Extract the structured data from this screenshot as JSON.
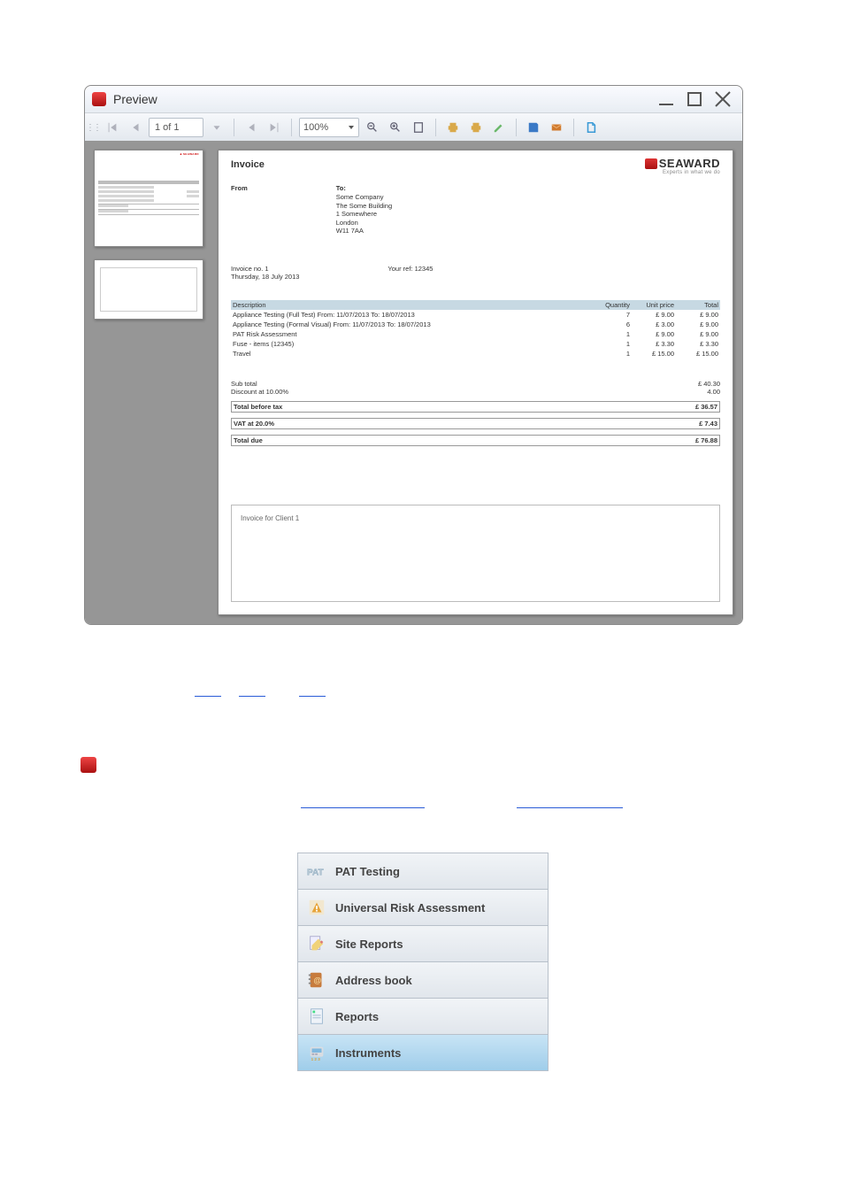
{
  "window": {
    "title": "Preview"
  },
  "toolbar": {
    "page_position": "1 of 1",
    "zoom": "100%"
  },
  "invoice": {
    "title": "Invoice",
    "brand_name": "SEAWARD",
    "brand_tagline": "Experts in what we do",
    "from_label": "From",
    "to_label": "To:",
    "to_lines": [
      "Some Company",
      "The Some Building",
      "1 Somewhere",
      "London",
      "W11 7AA"
    ],
    "invoice_no_label": "Invoice no. 1",
    "invoice_date": "Thursday, 18 July 2013",
    "your_ref_label": "Your ref: 12345"
  },
  "items": {
    "headers": {
      "desc": "Description",
      "qty": "Quantity",
      "unit": "Unit price",
      "total": "Total"
    },
    "rows": [
      {
        "desc": "Appliance Testing (Full Test)  From: 11/07/2013 To: 18/07/2013",
        "qty": "7",
        "unit": "£ 9.00",
        "total": "£ 9.00"
      },
      {
        "desc": "Appliance Testing (Formal Visual)  From: 11/07/2013 To: 18/07/2013",
        "qty": "6",
        "unit": "£ 3.00",
        "total": "£ 9.00"
      },
      {
        "desc": "PAT Risk Assessment",
        "qty": "1",
        "unit": "£ 9.00",
        "total": "£ 9.00"
      },
      {
        "desc": "Fuse - items (12345)",
        "qty": "1",
        "unit": "£ 3.30",
        "total": "£ 3.30"
      },
      {
        "desc": "Travel",
        "qty": "1",
        "unit": "£ 15.00",
        "total": "£ 15.00"
      }
    ]
  },
  "summary": {
    "subtotal_label": "Sub total",
    "subtotal_value": "£ 40.30",
    "discount_label": "Discount at 10.00%",
    "discount_value": "4.00",
    "net_label": "Total before tax",
    "net_value": "£ 36.57",
    "vat_label": "VAT at 20.0%",
    "vat_value": "£ 7.43",
    "due_label": "Total due",
    "due_value": "£ 76.88"
  },
  "notes": "Invoice for Client 1",
  "sidebar": {
    "items": [
      {
        "label": "PAT Testing"
      },
      {
        "label": "Universal Risk Assessment"
      },
      {
        "label": "Site Reports"
      },
      {
        "label": "Address book"
      },
      {
        "label": "Reports"
      },
      {
        "label": "Instruments"
      }
    ]
  }
}
